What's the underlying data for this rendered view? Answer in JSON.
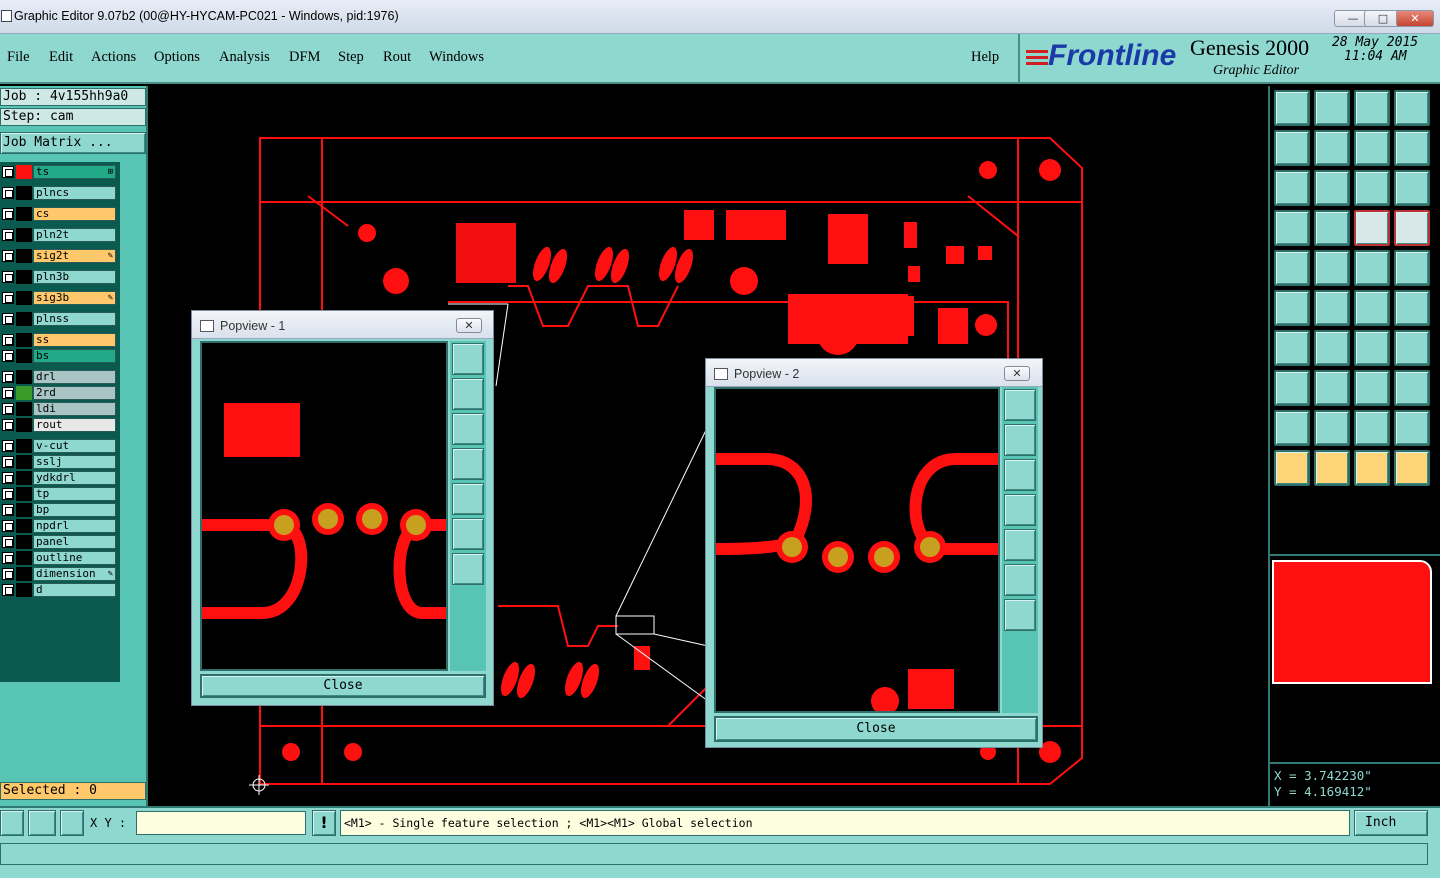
{
  "window": {
    "title": "Graphic Editor 9.07b2 (00@HY-HYCAM-PC021 - Windows, pid:1976)",
    "min": "—",
    "max": "□",
    "close": "✕"
  },
  "menu": {
    "items": [
      "File",
      "Edit",
      "Actions",
      "Options",
      "Analysis",
      "DFM",
      "Step",
      "Rout",
      "Windows"
    ],
    "help": "Help"
  },
  "brand": {
    "logo": "Frontline",
    "product": "Genesis 2000",
    "subtitle": "Graphic Editor",
    "date": "28 May 2015",
    "time": "11:04 AM"
  },
  "job": {
    "job": "Job : 4v155hh9a0",
    "step": "Step: cam",
    "matrix": "Job Matrix ..."
  },
  "layers": [
    {
      "name": "ts",
      "color": "#22aa88",
      "mark": "⊞",
      "swatch": "#ff1010"
    },
    {
      "name": "plncs",
      "color": "#8fd8d0",
      "mark": "",
      "swatch": "#000"
    },
    {
      "name": "cs",
      "color": "#ffc86a",
      "mark": "",
      "swatch": "#000"
    },
    {
      "name": "pln2t",
      "color": "#8fd8d0",
      "mark": "",
      "swatch": "#000"
    },
    {
      "name": "sig2t",
      "color": "#ffc86a",
      "mark": "✎",
      "swatch": "#000"
    },
    {
      "name": "pln3b",
      "color": "#8fd8d0",
      "mark": "",
      "swatch": "#000"
    },
    {
      "name": "sig3b",
      "color": "#ffc86a",
      "mark": "✎",
      "swatch": "#000"
    },
    {
      "name": "plnss",
      "color": "#8fd8d0",
      "mark": "",
      "swatch": "#000"
    },
    {
      "name": "ss",
      "color": "#ffc86a",
      "mark": "",
      "swatch": "#000"
    },
    {
      "name": "bs",
      "color": "#22aa88",
      "mark": "",
      "swatch": "#000"
    },
    {
      "name": "drl",
      "color": "#a8c4c4",
      "mark": "",
      "swatch": "#000"
    },
    {
      "name": "2rd",
      "color": "#a8c4c4",
      "mark": "",
      "swatch": "#3a9a2a"
    },
    {
      "name": "ldi",
      "color": "#a8c4c4",
      "mark": "",
      "swatch": "#000"
    },
    {
      "name": "rout",
      "color": "#e8e8e8",
      "mark": "",
      "swatch": "#000"
    },
    {
      "name": "v-cut",
      "color": "#8fd8d0",
      "mark": "",
      "swatch": "#000"
    },
    {
      "name": "sslj",
      "color": "#8fd8d0",
      "mark": "",
      "swatch": "#000"
    },
    {
      "name": "ydkdrl",
      "color": "#8fd8d0",
      "mark": "",
      "swatch": "#000"
    },
    {
      "name": "tp",
      "color": "#8fd8d0",
      "mark": "",
      "swatch": "#000"
    },
    {
      "name": "bp",
      "color": "#8fd8d0",
      "mark": "",
      "swatch": "#000"
    },
    {
      "name": "npdrl",
      "color": "#8fd8d0",
      "mark": "",
      "swatch": "#000"
    },
    {
      "name": "panel",
      "color": "#8fd8d0",
      "mark": "",
      "swatch": "#000"
    },
    {
      "name": "outline",
      "color": "#8fd8d0",
      "mark": "",
      "swatch": "#000"
    },
    {
      "name": "dimension",
      "color": "#8fd8d0",
      "mark": "✎",
      "swatch": "#000"
    },
    {
      "name": "d",
      "color": "#8fd8d0",
      "mark": "",
      "swatch": "#000"
    }
  ],
  "selected": "Selected : 0",
  "popup1": {
    "title": "Popview - 1",
    "close": "Close"
  },
  "popup2": {
    "title": "Popview - 2",
    "close": "Close"
  },
  "coords": {
    "x": "X = 3.742230\"",
    "y": "Y = 4.169412\""
  },
  "status": {
    "xy_label": "X Y :",
    "xy_value": "",
    "message": "<M1> - Single feature selection ; <M1><M1> Global selection",
    "unit": "Inch"
  },
  "colors": {
    "copper": "#ff1010",
    "pad": "#c8a020",
    "panel": "#8fd8d0",
    "border": "#2f6f69"
  }
}
